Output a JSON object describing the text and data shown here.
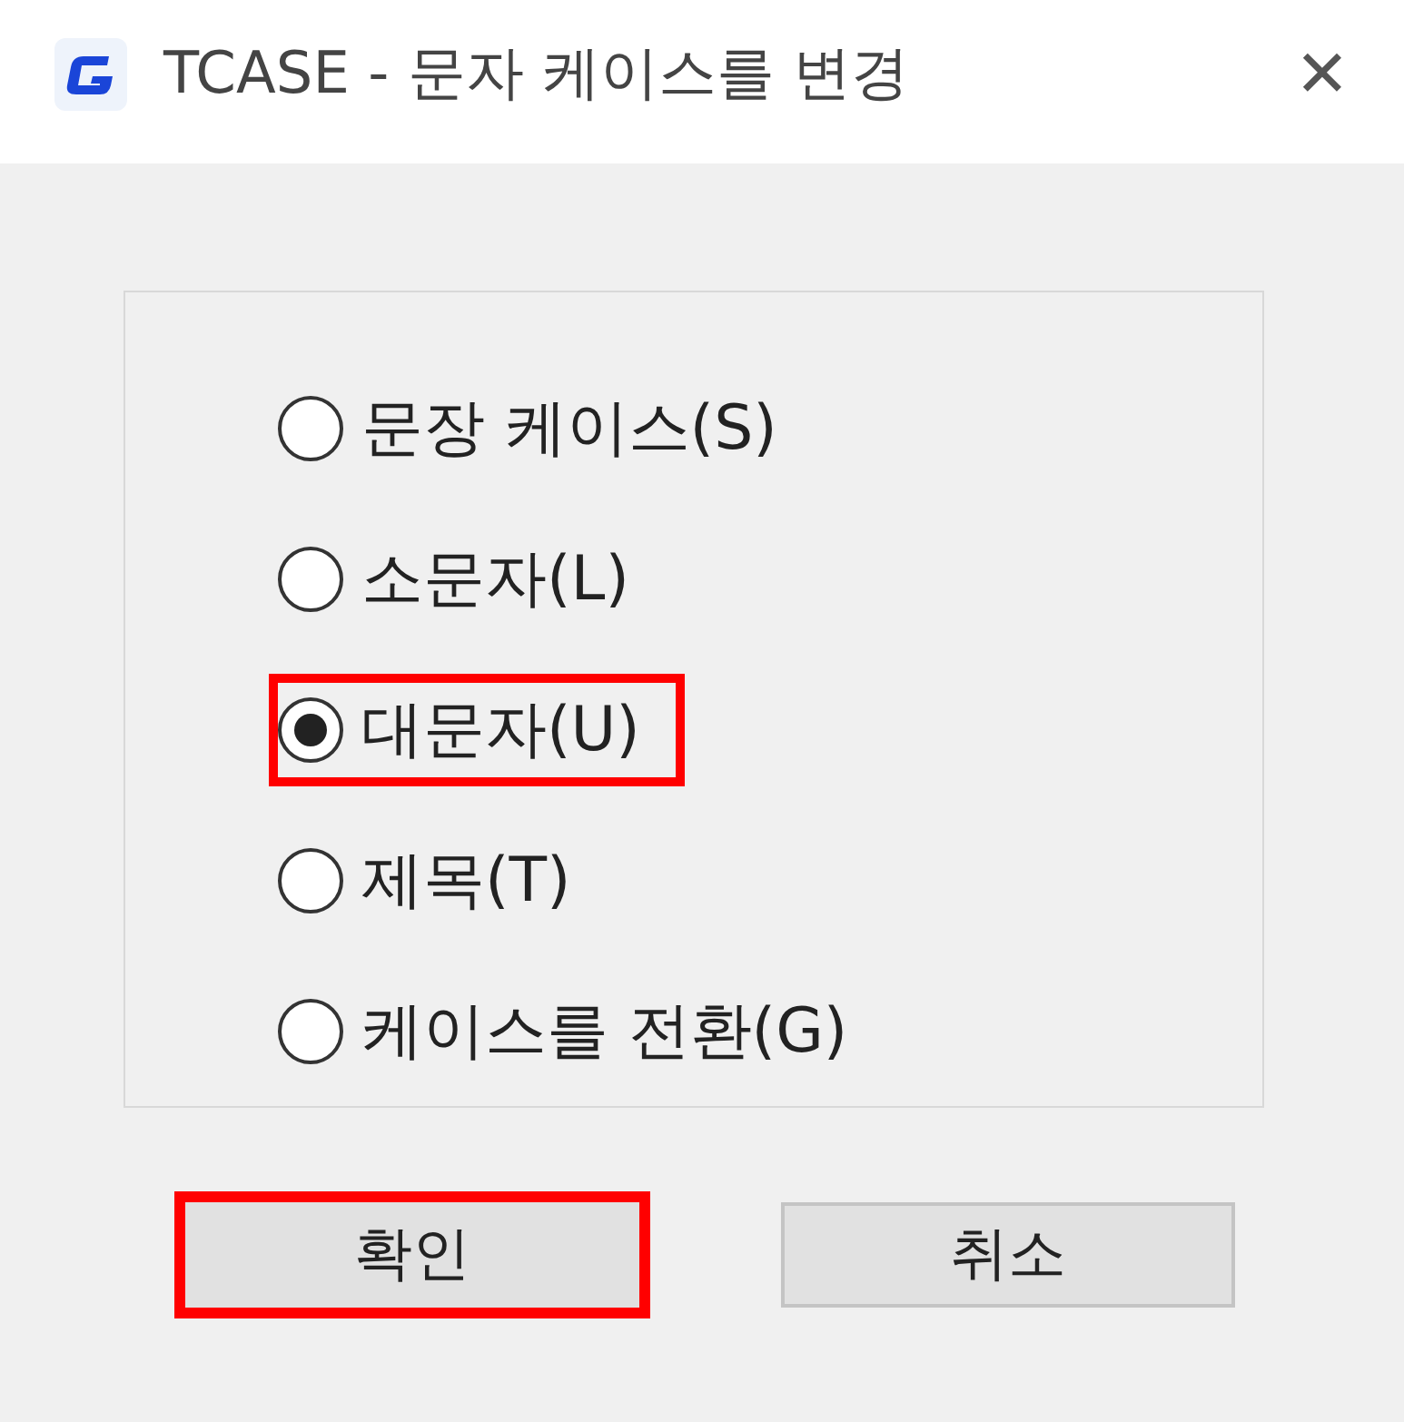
{
  "window": {
    "title": "TCASE - 문자 케이스를 변경",
    "close": "✕"
  },
  "options": [
    {
      "label": "문장 케이스(S)",
      "selected": false,
      "highlighted": false
    },
    {
      "label": "소문자(L)",
      "selected": false,
      "highlighted": false
    },
    {
      "label": "대문자(U)",
      "selected": true,
      "highlighted": true
    },
    {
      "label": "제목(T)",
      "selected": false,
      "highlighted": false
    },
    {
      "label": "케이스를 전환(G)",
      "selected": false,
      "highlighted": false
    }
  ],
  "buttons": [
    {
      "label": "확인",
      "highlighted": true
    },
    {
      "label": "취소",
      "highlighted": false
    }
  ]
}
